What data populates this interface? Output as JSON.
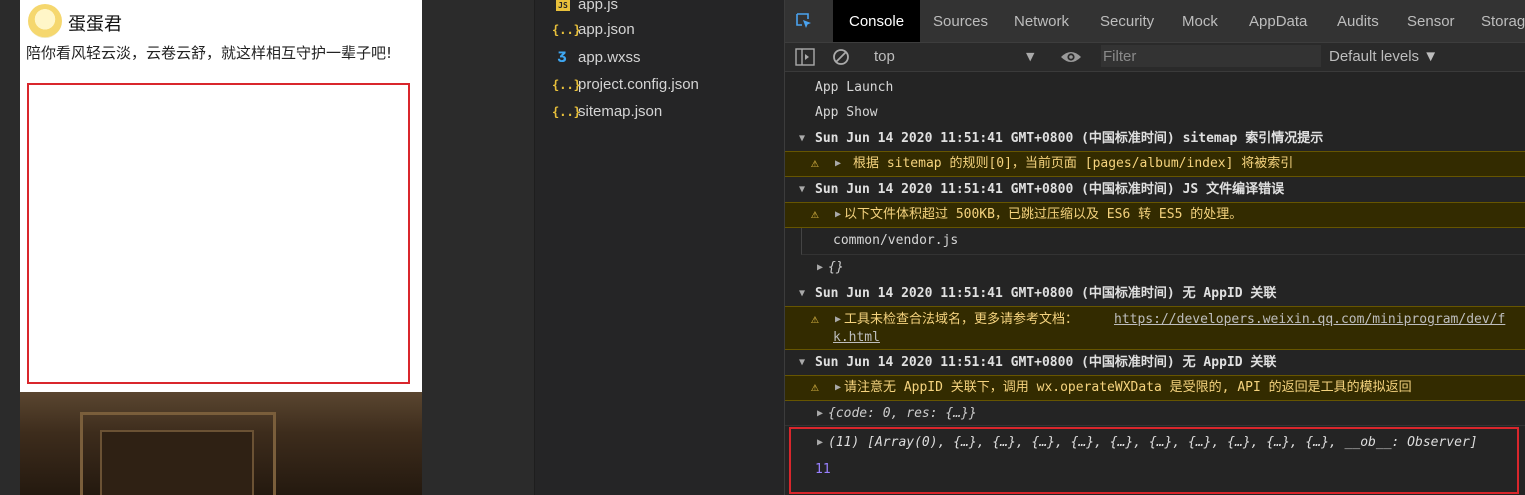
{
  "simulator": {
    "username": "蛋蛋君",
    "poem": "陪你看风轻云淡，云卷云舒，就这样相互守护一辈子吧!"
  },
  "filetree": {
    "files": [
      {
        "name": "app.js",
        "type": "js"
      },
      {
        "name": "app.json",
        "type": "json"
      },
      {
        "name": "app.wxss",
        "type": "css"
      },
      {
        "name": "project.config.json",
        "type": "json"
      },
      {
        "name": "sitemap.json",
        "type": "json"
      }
    ]
  },
  "devtools": {
    "tabs": [
      "Console",
      "Sources",
      "Network",
      "Security",
      "Mock",
      "AppData",
      "Audits",
      "Sensor",
      "Storage"
    ],
    "context": "top",
    "filter_placeholder": "Filter",
    "levels": "Default levels ▼",
    "console": {
      "app_launch": "App Launch",
      "app_show": "App Show",
      "group1_header": "Sun Jun 14 2020 11:51:41 GMT+0800 (中国标准时间) sitemap 索引情况提示",
      "group1_warn": "根据 sitemap 的规则[0]，当前页面 [pages/album/index] 将被索引",
      "group2_header": "Sun Jun 14 2020 11:51:41 GMT+0800 (中国标准时间) JS 文件编译错误",
      "group2_warn": "以下文件体积超过 500KB，已跳过压缩以及 ES6 转 ES5 的处理。",
      "group2_file": "common/vendor.js",
      "group2_obj": "{}",
      "group3_header": "Sun Jun 14 2020 11:51:41 GMT+0800 (中国标准时间) 无 AppID 关联",
      "group3_warn_prefix": "工具未检查合法域名，更多请参考文档：",
      "group3_link_line1": "https://developers.weixin.qq.com/miniprogram/dev/f",
      "group3_link_line2": "k.html",
      "group4_header": "Sun Jun 14 2020 11:51:41 GMT+0800 (中国标准时间) 无 AppID 关联",
      "group4_warn": "请注意无 AppID 关联下，调用 wx.operateWXData 是受限的, API 的返回是工具的模拟返回",
      "obj_line": "{code: 0, res: {…}}",
      "array_line": "(11) [Array(0), {…}, {…}, {…}, {…}, {…}, {…}, {…}, {…}, {…}, {…}, __ob__: Observer]",
      "count": "11"
    }
  }
}
